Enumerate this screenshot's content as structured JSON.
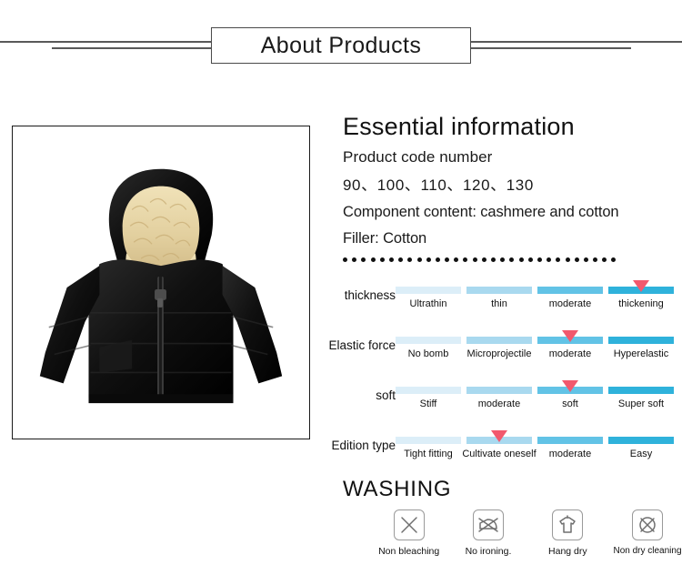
{
  "banner": {
    "title": "About Products"
  },
  "product_image": {
    "alt": "black hooded puffer jacket with cream fleece lining",
    "jacket_color": "#121212",
    "lining_color": "#e7d6a8",
    "frame_border_color": "#1a1a1a"
  },
  "info": {
    "heading": "Essential information",
    "product_code_label": "Product code number",
    "product_codes": "90、100、110、120、130",
    "component_content": "Component content: cashmere and cotton",
    "filler": "Filler: Cotton",
    "divider_dot_count": 30
  },
  "ratings": {
    "bar_colors": [
      "#dceef8",
      "#a9d9ef",
      "#62c3e6",
      "#2fb2db"
    ],
    "marker_color": "#f2596e",
    "rows": [
      {
        "label": "thickness",
        "options": [
          "Ultrathin",
          "thin",
          "moderate",
          "thickening"
        ],
        "selected_index": 3
      },
      {
        "label": "Elastic force",
        "options": [
          "No bomb",
          "Microprojectile",
          "moderate",
          "Hyperelastic"
        ],
        "selected_index": 2
      },
      {
        "label": "soft",
        "options": [
          "Stiff",
          "moderate",
          "soft",
          "Super soft"
        ],
        "selected_index": 2
      },
      {
        "label": "Edition type",
        "options": [
          "Tight fitting",
          "Cultivate oneself",
          "moderate",
          "Easy"
        ],
        "selected_index": 1
      }
    ]
  },
  "washing": {
    "heading": "WASHING",
    "icons": [
      {
        "icon": "bleach-crossed-icon",
        "label": "Non bleaching"
      },
      {
        "icon": "iron-crossed-icon",
        "label": "No ironing."
      },
      {
        "icon": "hang-dry-shirt-icon",
        "label": "Hang dry"
      },
      {
        "icon": "dry-clean-crossed-icon",
        "label": "Non dry cleaning"
      }
    ]
  }
}
